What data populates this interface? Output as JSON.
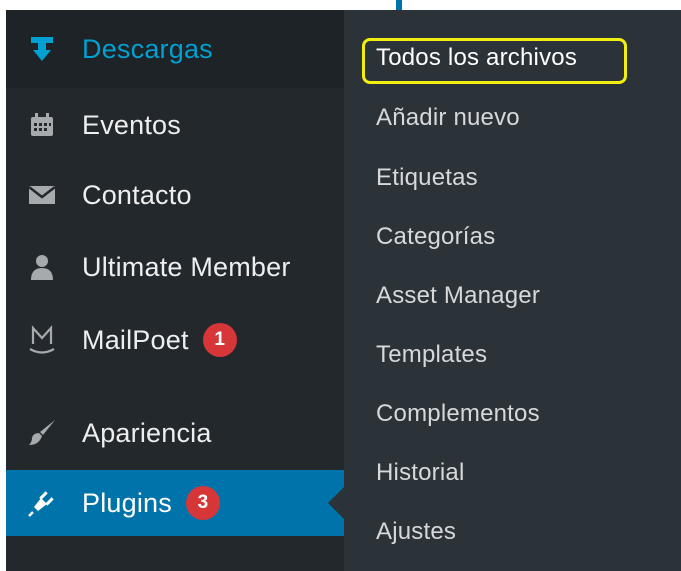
{
  "sidebar": {
    "items": [
      {
        "label": "Descargas",
        "icon": "download-icon",
        "active_color": "#00a0d2"
      },
      {
        "label": "Eventos",
        "icon": "calendar-icon"
      },
      {
        "label": "Contacto",
        "icon": "envelope-icon"
      },
      {
        "label": "Ultimate Member",
        "icon": "user-icon"
      },
      {
        "label": "MailPoet",
        "icon": "mailpoet-icon",
        "badge": "1"
      },
      {
        "label": "Apariencia",
        "icon": "paintbrush-icon"
      },
      {
        "label": "Plugins",
        "icon": "plugin-icon",
        "badge": "3"
      }
    ]
  },
  "submenu": {
    "items": [
      {
        "label": "Todos los archivos",
        "highlighted": true
      },
      {
        "label": "Añadir nuevo"
      },
      {
        "label": "Etiquetas"
      },
      {
        "label": "Categorías"
      },
      {
        "label": "Asset Manager"
      },
      {
        "label": "Templates"
      },
      {
        "label": "Complementos"
      },
      {
        "label": "Historial"
      },
      {
        "label": "Ajustes"
      }
    ]
  },
  "colors": {
    "sidebar_bg": "#23282d",
    "submenu_bg": "#2c3338",
    "accent_blue": "#0073aa",
    "active_text": "#00a0d2",
    "badge_red": "#d63638",
    "highlight_yellow": "#f2ee0f"
  }
}
